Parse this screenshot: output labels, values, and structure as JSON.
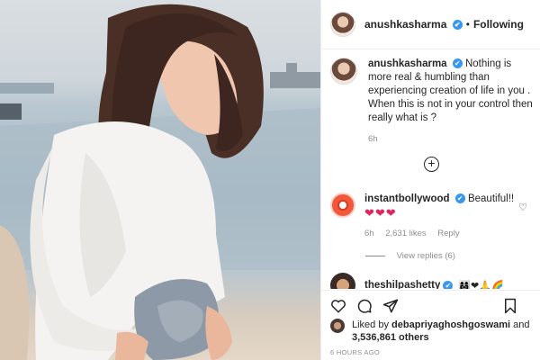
{
  "post": {
    "author": "anushkasharma",
    "follow_label": "Following",
    "separator": "•",
    "caption": "Nothing is more real & humbling than experiencing creation of life in you . When this is not in your control then really what is ?",
    "caption_time": "6h",
    "add_comment_icon": "+"
  },
  "comments": [
    {
      "author": "instantbollywood",
      "text": "Beautiful!!",
      "hearts": "❤❤❤",
      "time": "6h",
      "likes": "2,631 likes",
      "reply_label": "Reply",
      "view_replies": "View replies (6)"
    },
    {
      "author": "theshilpashetty",
      "emoji": "👩‍👩‍👧❤🙏🌈"
    }
  ],
  "likes": {
    "prefix": "Liked by",
    "user": "debapriyaghoshgoswami",
    "and": "and",
    "count": "3,536,861 others"
  },
  "timestamp": "6 HOURS AGO",
  "icons": {
    "verified": "✔",
    "comment_heart": "♡"
  },
  "colors": {
    "verified": "#3897f0",
    "hearts": "#e0245e",
    "muted": "#8e8e8e"
  }
}
